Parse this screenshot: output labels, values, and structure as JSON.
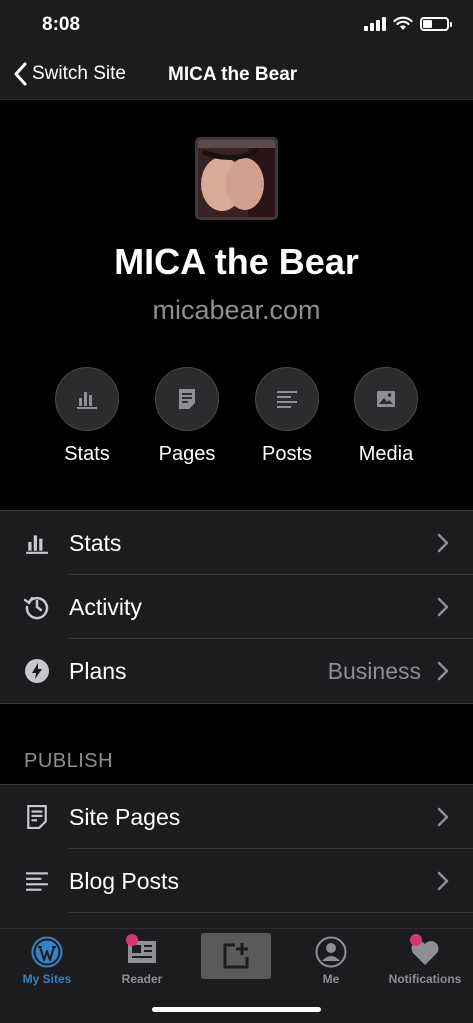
{
  "status_bar": {
    "time": "8:08"
  },
  "nav": {
    "back_label": "Switch Site",
    "title": "MICA the Bear"
  },
  "site": {
    "name": "MICA the Bear",
    "url": "micabear.com"
  },
  "quick_actions": [
    {
      "label": "Stats",
      "icon": "stats-icon"
    },
    {
      "label": "Pages",
      "icon": "pages-icon"
    },
    {
      "label": "Posts",
      "icon": "posts-icon"
    },
    {
      "label": "Media",
      "icon": "media-icon"
    }
  ],
  "stats_section": {
    "rows": [
      {
        "label": "Stats",
        "icon": "stats-icon",
        "detail": ""
      },
      {
        "label": "Activity",
        "icon": "history-icon",
        "detail": ""
      },
      {
        "label": "Plans",
        "icon": "plans-icon",
        "detail": "Business"
      }
    ]
  },
  "publish_section": {
    "title": "PUBLISH",
    "rows": [
      {
        "label": "Site Pages",
        "icon": "pages-icon"
      },
      {
        "label": "Blog Posts",
        "icon": "posts-icon"
      }
    ]
  },
  "tabs": [
    {
      "label": "My Sites",
      "icon": "wordpress-icon",
      "active": true
    },
    {
      "label": "Reader",
      "icon": "reader-icon",
      "active": false
    },
    {
      "label": "",
      "icon": "compose-icon",
      "active": false
    },
    {
      "label": "Me",
      "icon": "avatar-icon",
      "active": false
    },
    {
      "label": "Notifications",
      "icon": "notifications-icon",
      "active": false
    }
  ],
  "colors": {
    "background": "#000000",
    "surface": "#1c1c1e",
    "secondary_text": "#8e8e93",
    "accent": "#3582c4",
    "badge": "#d63672"
  }
}
